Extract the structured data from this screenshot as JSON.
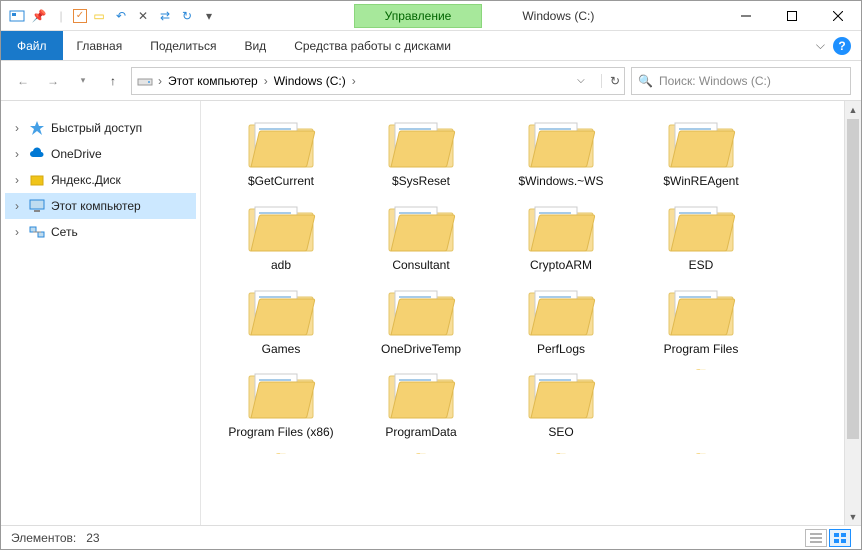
{
  "window": {
    "title": "Windows (C:)",
    "manage": "Управление"
  },
  "ribbon": {
    "file": "Файл",
    "tabs": [
      "Главная",
      "Поделиться",
      "Вид"
    ],
    "context_tab": "Средства работы с дисками"
  },
  "address": {
    "segments": [
      "Этот компьютер",
      "Windows (C:)"
    ]
  },
  "search": {
    "placeholder": "Поиск: Windows (C:)"
  },
  "tree": {
    "items": [
      {
        "label": "Быстрый доступ",
        "icon": "star",
        "color": "#2b88d8"
      },
      {
        "label": "OneDrive",
        "icon": "cloud",
        "color": "#0078d4"
      },
      {
        "label": "Яндекс.Диск",
        "icon": "ydisk",
        "color": "#f0c419"
      },
      {
        "label": "Этот компьютер",
        "icon": "monitor",
        "color": "#2b88d8",
        "selected": true
      },
      {
        "label": "Сеть",
        "icon": "network",
        "color": "#2b88d8"
      }
    ]
  },
  "folders": [
    "$GetCurrent",
    "$SysReset",
    "$Windows.~WS",
    "$WinREAgent",
    "adb",
    "Consultant",
    "CryptoARM",
    "ESD",
    "Games",
    "OneDriveTemp",
    "PerfLogs",
    "Program Files",
    "Program Files (x86)",
    "ProgramData",
    "SEO"
  ],
  "status": {
    "elements_label": "Элементов:",
    "count": "23"
  }
}
